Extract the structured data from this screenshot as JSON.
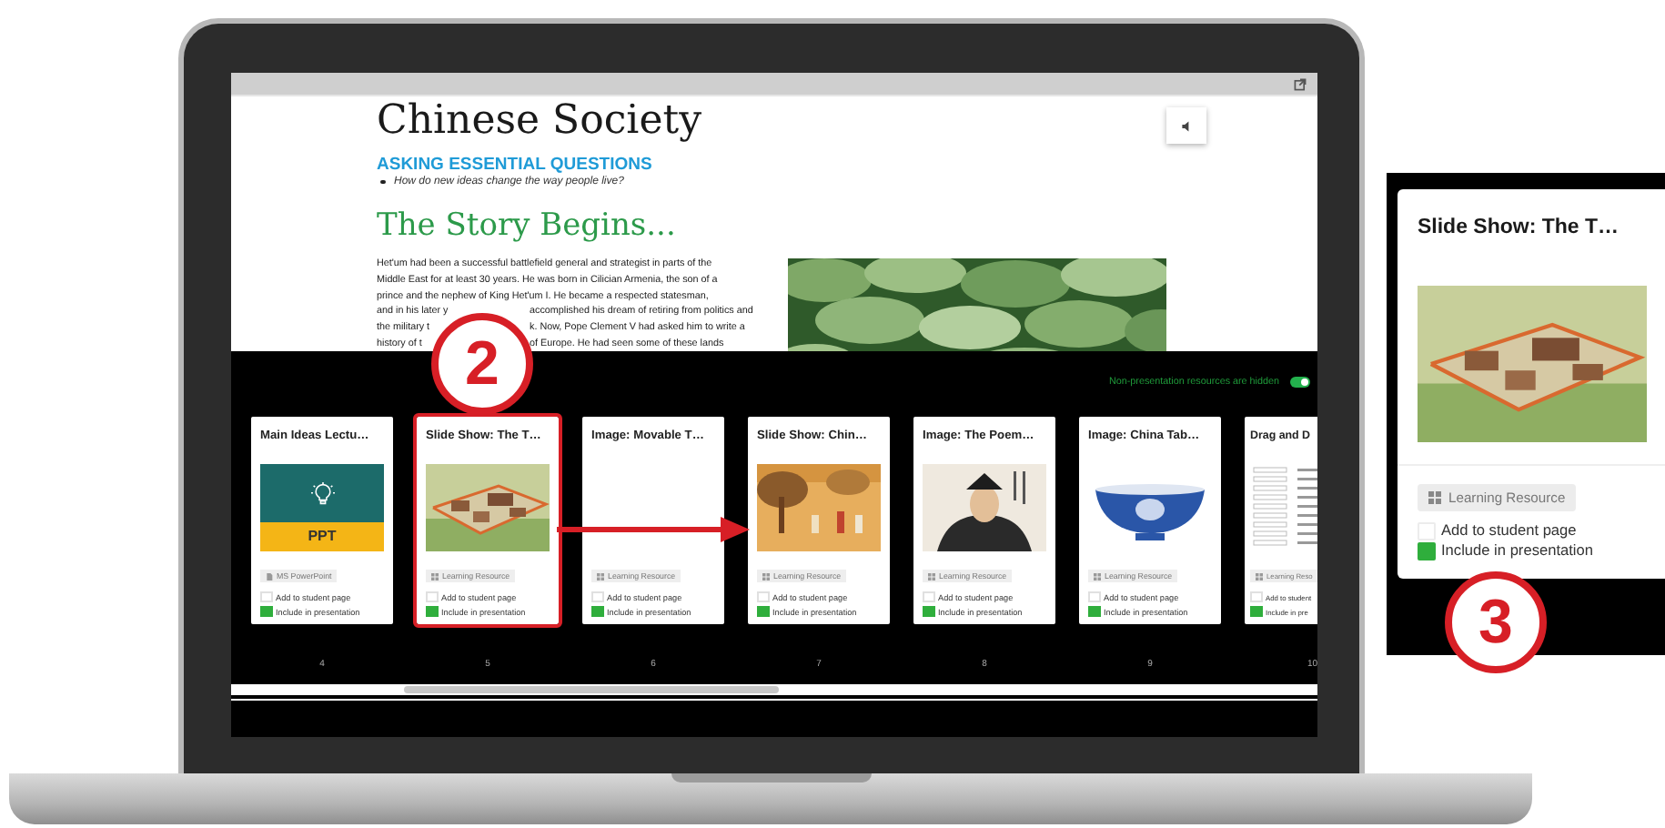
{
  "document": {
    "title": "Chinese Society",
    "subtitle": "ASKING ESSENTIAL QUESTIONS",
    "questions": [
      "How do new ideas change the way people live?"
    ],
    "heading": "The Story Begins...",
    "paragraph_lines": [
      [
        "Het'um had been a successful battlefield general and strategist in parts of the"
      ],
      [
        "Middle East for at least 30 years. He was born in Cilician Armenia, the son of a"
      ],
      [
        "prince and the nephew of King Het'um I. He became a respected statesman,"
      ],
      [
        "and in his later y",
        "accomplished his dream of retiring from politics and"
      ],
      [
        "the military t",
        "k. Now, Pope Clement V had asked him to write a"
      ],
      [
        "history of t",
        "of Europe. He had seen some of these lands"
      ]
    ]
  },
  "resources_toggle": {
    "label": "Non-presentation resources are hidden",
    "on": true
  },
  "cards": [
    {
      "title": "Main Ideas Lectu…",
      "kind": "ppt",
      "thumb_label": "PPT",
      "tag": "MS PowerPoint",
      "add_label": "Add to student page",
      "add_to_student_page": false,
      "include_label": "Include in presentation",
      "include_in_presentation": true,
      "number": "4",
      "selected": false
    },
    {
      "title": "Slide Show: The T…",
      "kind": "picture",
      "tag": "Learning Resource",
      "add_label": "Add to student page",
      "add_to_student_page": false,
      "include_label": "Include in presentation",
      "include_in_presentation": true,
      "number": "5",
      "selected": true
    },
    {
      "title": "Image: Movable T…",
      "kind": "blank",
      "tag": "Learning Resource",
      "add_label": "Add to student page",
      "add_to_student_page": false,
      "include_label": "Include in presentation",
      "include_in_presentation": true,
      "number": "6",
      "selected": false
    },
    {
      "title": "Slide Show: Chin…",
      "kind": "picture",
      "tag": "Learning Resource",
      "add_label": "Add to student page",
      "add_to_student_page": false,
      "include_label": "Include in presentation",
      "include_in_presentation": true,
      "number": "7",
      "selected": false
    },
    {
      "title": "Image: The Poem…",
      "kind": "picture",
      "tag": "Learning Resource",
      "add_label": "Add to student page",
      "add_to_student_page": false,
      "include_label": "Include in presentation",
      "include_in_presentation": true,
      "number": "8",
      "selected": false
    },
    {
      "title": "Image: China Tab…",
      "kind": "picture",
      "tag": "Learning Resource",
      "add_label": "Add to student page",
      "add_to_student_page": false,
      "include_label": "Include in presentation",
      "include_in_presentation": true,
      "number": "9",
      "selected": false
    },
    {
      "title": "Drag and D",
      "kind": "list",
      "tag": "Learning Reso",
      "add_label": "Add to student",
      "add_to_student_page": false,
      "include_label": "Include in pre",
      "include_in_presentation": true,
      "number": "10",
      "selected": false
    }
  ],
  "callouts": [
    "2",
    "3"
  ],
  "zoomed_card": {
    "title": "Slide Show: The T…",
    "tag": "Learning Resource",
    "add_label": "Add to student page",
    "add_to_student_page": false,
    "include_label": "Include in presentation",
    "include_in_presentation": true
  }
}
